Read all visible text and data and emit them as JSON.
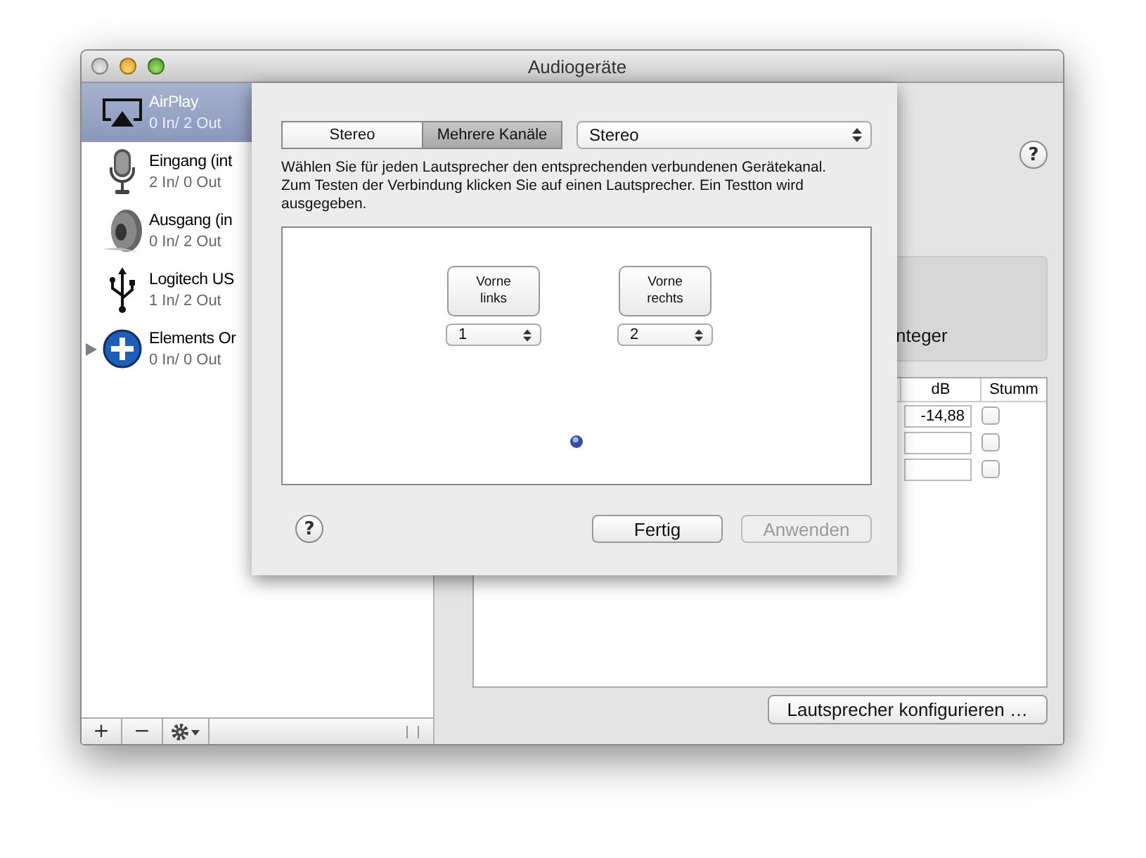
{
  "window": {
    "title": "Audiogeräte"
  },
  "help_label": "?",
  "sidebar": {
    "devices": [
      {
        "kind": "airplay",
        "name": "AirPlay",
        "io": "0 In/ 2 Out",
        "selected": true,
        "expandable": false
      },
      {
        "kind": "microphone",
        "name": "Eingang (int",
        "io": "2 In/ 0 Out",
        "selected": false,
        "expandable": false
      },
      {
        "kind": "speaker",
        "name": "Ausgang (in",
        "io": "0 In/ 2 Out",
        "selected": false,
        "expandable": false
      },
      {
        "kind": "usb",
        "name": "Logitech US",
        "io": "1 In/ 2 Out",
        "selected": false,
        "expandable": false
      },
      {
        "kind": "aggregate",
        "name": "Elements Or",
        "io": "0 In/ 0 Out",
        "selected": false,
        "expandable": true
      }
    ],
    "toolbar": [
      "+",
      "−"
    ]
  },
  "detail": {
    "format_text": "nteger",
    "table": {
      "columns": [
        "dB",
        "Stumm"
      ],
      "rows": [
        {
          "db": "-14,88",
          "muted": false
        },
        {
          "muted": false
        },
        {
          "muted": false
        }
      ]
    },
    "configure_button": "Lautsprecher konfigurieren …"
  },
  "sheet": {
    "modes": [
      {
        "label": "Stereo",
        "selected": false
      },
      {
        "label": "Mehrere Kanäle",
        "selected": true
      }
    ],
    "preset": "Stereo",
    "instructions": "Wählen Sie für jeden Lautsprecher den entsprechenden verbundenen Gerätekanal. Zum Testen der Verbindung klicken Sie auf einen Lautsprecher. Ein Testton wird ausgegeben.",
    "speakers": [
      {
        "label": "Vorne links",
        "channel": "1"
      },
      {
        "label": "Vorne rechts",
        "channel": "2"
      }
    ],
    "buttons": [
      {
        "label": "Fertig",
        "disabled": false
      },
      {
        "label": "Anwenden",
        "disabled": true
      }
    ]
  }
}
